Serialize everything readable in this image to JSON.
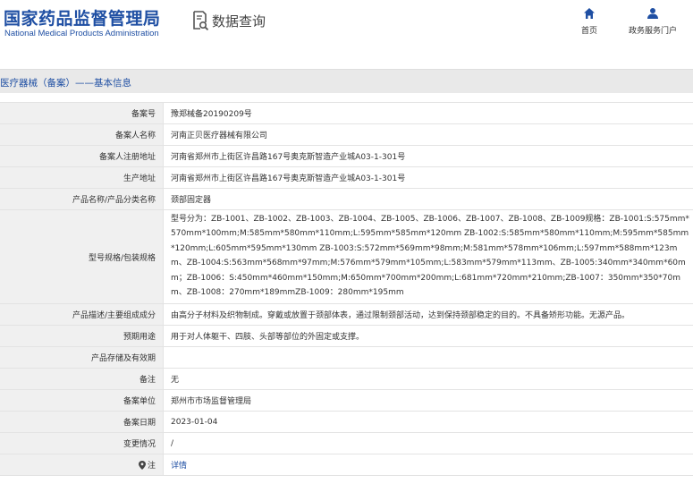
{
  "header": {
    "logo_cn": "国家药品监督管理局",
    "logo_en": "National Medical Products Administration",
    "query_label": "数据查询",
    "query_icon": "search-document-icon",
    "nav": [
      {
        "label": "首页",
        "icon": "home-icon"
      },
      {
        "label": "政务服务门户",
        "icon": "user-icon"
      }
    ],
    "accent_color": "#1f4fa3"
  },
  "breadcrumb": "医疗器械（备案）——基本信息",
  "table": {
    "rows": [
      {
        "label": "备案号",
        "value": "豫郑械备20190209号"
      },
      {
        "label": "备案人名称",
        "value": "河南正贝医疗器械有限公司"
      },
      {
        "label": "备案人注册地址",
        "value": "河南省郑州市上街区许昌路167号奥克斯智造产业城A03-1-301号"
      },
      {
        "label": "生产地址",
        "value": "河南省郑州市上街区许昌路167号奥克斯智造产业城A03-1-301号"
      },
      {
        "label": "产品名称/产品分类名称",
        "value": "颈部固定器"
      },
      {
        "label": "型号规格/包装规格",
        "value": "型号分为：ZB-1001、ZB-1002、ZB-1003、ZB-1004、ZB-1005、ZB-1006、ZB-1007、ZB-1008、ZB-1009规格：ZB-1001:S:575mm*570mm*100mm;M:585mm*580mm*110mm;L:595mm*585mm*120mm ZB-1002:S:585mm*580mm*110mm;M:595mm*585mm*120mm;L:605mm*595mm*130mm ZB-1003:S:572mm*569mm*98mm;M:581mm*578mm*106mm;L:597mm*588mm*123mm、ZB-1004:S:563mm*568mm*97mm;M:576mm*579mm*105mm;L:583mm*579mm*113mm、ZB-1005:340mm*340mm*60mm；ZB-1006：S:450mm*460mm*150mm;M:650mm*700mm*200mm;L:681mm*720mm*210mm;ZB-1007：350mm*350*70mm、ZB-1008：270mm*189mmZB-1009：280mm*195mm"
      },
      {
        "label": "产品描述/主要组成成分",
        "value": "由高分子材料及织物制成。穿戴或放置于颈部体表，通过限制颈部活动，达到保持颈部稳定的目的。不具备矫形功能。无源产品。"
      },
      {
        "label": "预期用途",
        "value": "用于对人体躯干、四肢、头部等部位的外固定或支撑。"
      },
      {
        "label": "产品存储及有效期",
        "value": ""
      },
      {
        "label": "备注",
        "value": "无"
      },
      {
        "label": "备案单位",
        "value": "郑州市市场监督管理局"
      },
      {
        "label": "备案日期",
        "value": "2023-01-04"
      },
      {
        "label": "变更情况",
        "value": "/"
      },
      {
        "label": "注",
        "value": "详情",
        "icon": "pin-icon"
      }
    ]
  }
}
